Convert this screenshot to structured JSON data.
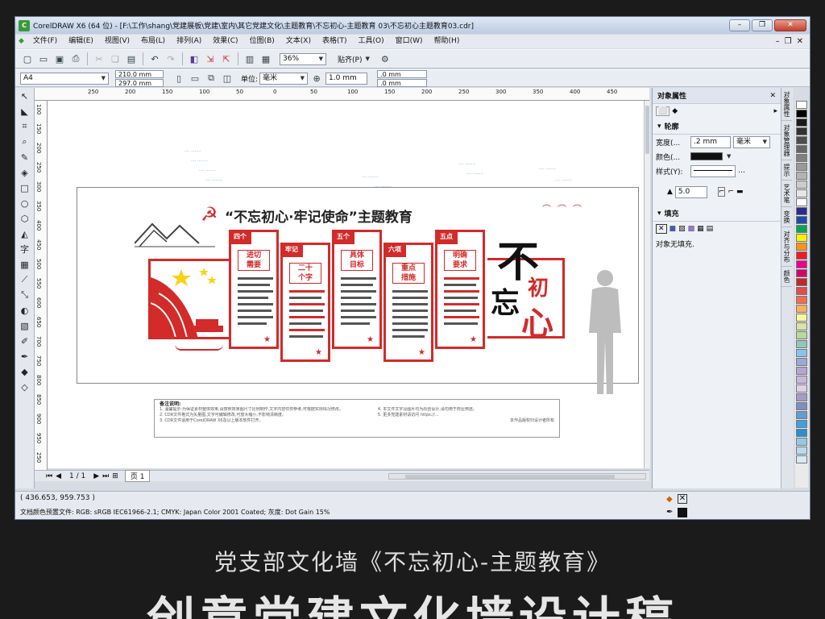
{
  "window": {
    "title": "CorelDRAW X6 (64 位) - [F:\\工作\\shang\\党建展板\\党建\\室内\\其它党建文化\\主题教育\\不忘初心-主题教育 03\\不忘初心主题教育03.cdr]",
    "app_icon": "coreldraw-icon"
  },
  "menu": [
    "文件(F)",
    "编辑(E)",
    "视图(V)",
    "布局(L)",
    "排列(A)",
    "效果(C)",
    "位图(B)",
    "文本(X)",
    "表格(T)",
    "工具(O)",
    "窗口(W)",
    "帮助(H)"
  ],
  "toolbar1": {
    "zoom": "36%",
    "snap_label": "贴齐(P)"
  },
  "toolbar2": {
    "page_size": "A4",
    "width": "210.0 mm",
    "height": "297.0 mm",
    "units_label": "单位:",
    "units": "毫米",
    "nudge": "1.0 mm",
    "dup_x": ".0 mm",
    "dup_y": ".0 mm"
  },
  "ruler": {
    "h_labels": [
      "250",
      "200",
      "150",
      "100",
      "50",
      "0",
      "50",
      "100",
      "150",
      "200",
      "250",
      "300",
      "350",
      "400",
      "450"
    ],
    "v_labels": [
      "100",
      "150",
      "200",
      "250",
      "300",
      "350",
      "400",
      "450",
      "500",
      "550",
      "600",
      "650",
      "700",
      "750",
      "800",
      "850",
      "900",
      "950",
      "250"
    ]
  },
  "design": {
    "title": "“不忘初心·牢记使命”主题教育",
    "calligraphy": [
      "不",
      "忘",
      "初",
      "心"
    ],
    "banners": [
      {
        "head": "四个",
        "box": "进切\n需要"
      },
      {
        "head": "牢记",
        "box": "二十\n个字"
      },
      {
        "head": "五个",
        "box": "具体\n目标"
      },
      {
        "head": "六项",
        "box": "重点\n措施"
      },
      {
        "head": "五点",
        "box": "明确\n要求"
      }
    ],
    "notes_title": "备注说明:",
    "notes_left": [
      "1. 温馨提示:为保证素材整体效果,请按照效果图尺寸比例制作,文字内容仅供参考,可根据实际情况修改。",
      "2. CDR文件格式为矢量图,文字可编辑修改,可放大缩小,不影响清晰度。",
      "3. CDR文件适用于CorelDRAW X6及以上版本软件打开。"
    ],
    "notes_right": [
      "4. 本文件文字及图片均为原创设计,请勿用于商业用途。",
      "5. 更多党建素材请访问 https://...",
      "本作品版权归设计者所有"
    ]
  },
  "panel": {
    "title": "对象属性",
    "outline_label": "轮廓",
    "width_label": "宽度(...",
    "width_value": ".2 mm",
    "width_unit": "毫米",
    "color_label": "颜色(...",
    "style_label": "样式(Y):",
    "miter_value": "5.0",
    "fill_label": "填充",
    "no_fill_text": "对象无填充."
  },
  "docker_tabs": [
    "对象属性",
    "对象管理器",
    "提示",
    "艺术笔",
    "变换",
    "对齐与分布",
    "颜色"
  ],
  "pages": {
    "counter": "1 / 1",
    "page_tab": "页 1"
  },
  "status": {
    "coords": "( 436.653, 959.753 )",
    "profile": "文档颜色预置文件: RGB: sRGB IEC61966-2.1; CMYK: Japan Color 2001 Coated; 灰度: Dot Gain 15%"
  },
  "caption": {
    "line1": "党支部文化墙《不忘初心-主题教育》",
    "line2": "创意党建文化墙设计稿"
  },
  "colors": {
    "party_red": "#d32a2a",
    "figure_gray": "#bdbdbd",
    "palette": [
      "#ffffff",
      "#000000",
      "#1a1a1a",
      "#333333",
      "#4d4d4d",
      "#666666",
      "#808080",
      "#999999",
      "#b3b3b3",
      "#cccccc",
      "#e6e6e6",
      "#ffffff",
      "#2b2b8f",
      "#1f4aa8",
      "#00a651",
      "#fff200",
      "#f7941d",
      "#ed1c24",
      "#ec008c",
      "#d8006c",
      "#c1272d",
      "#e14d4d",
      "#f26c4f",
      "#fbaf5d",
      "#fff799",
      "#d7e3a8",
      "#b9d7a2",
      "#92c6b8",
      "#8ac3e8",
      "#9aa9d6",
      "#b3a6d3",
      "#c9b6dd",
      "#ded1e8",
      "#a49bc9",
      "#7c8ec3",
      "#5f9ed6",
      "#3ea0dc",
      "#2b8ed1",
      "#93c9e8",
      "#b8dcef",
      "#d5ebf7"
    ]
  }
}
